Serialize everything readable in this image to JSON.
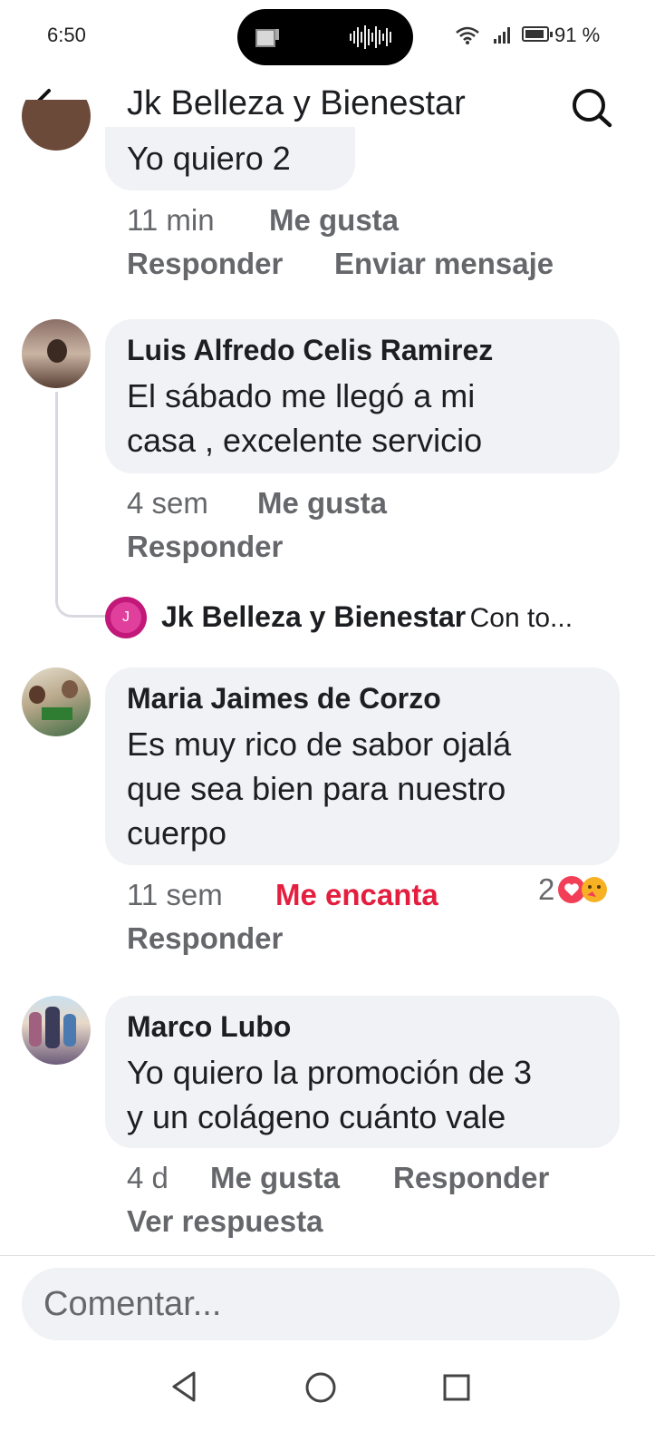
{
  "status_bar": {
    "time": "6:50",
    "battery": "91 %",
    "battery_level": 0.91
  },
  "header": {
    "title": "Jk Belleza y Bienestar"
  },
  "comments": [
    {
      "text": "Yo quiero 2",
      "time": "11 min",
      "like": "Me gusta",
      "reply": "Responder",
      "message": "Enviar mensaje"
    },
    {
      "author": "Luis Alfredo Celis Ramirez",
      "text_lines": [
        "El sábado me llegó a mi",
        "casa , excelente servicio"
      ],
      "time": "4 sem",
      "like": "Me gusta",
      "reply": "Responder",
      "page_reply": {
        "author": "Jk Belleza y Bienestar",
        "snippet": "Con to..."
      }
    },
    {
      "author": "Maria Jaimes de Corzo",
      "text_lines": [
        "Es muy rico de sabor ojalá",
        "que sea bien para nuestro",
        "cuerpo"
      ],
      "time": "11 sem",
      "reaction_label": "Me encanta",
      "reaction_count": "2",
      "reply": "Responder"
    },
    {
      "author": "Marco Lubo",
      "text_lines": [
        "Yo quiero la promoción de 3",
        "y un colágeno cuánto vale"
      ],
      "time": "4 d",
      "like": "Me gusta",
      "reply": "Responder",
      "view_replies": "Ver respuesta"
    }
  ],
  "composer": {
    "placeholder": "Comentar..."
  },
  "colors": {
    "bubble": "#f0f2f5",
    "meta": "#65676b",
    "love": "#e41e3f",
    "brand_pink": "#c2187a"
  },
  "icons": [
    "back-arrow-icon",
    "search-icon",
    "wifi-icon",
    "signal-icon",
    "battery-icon",
    "heart-reaction-icon",
    "care-reaction-icon",
    "nav-back-icon",
    "nav-home-icon",
    "nav-recents-icon"
  ]
}
